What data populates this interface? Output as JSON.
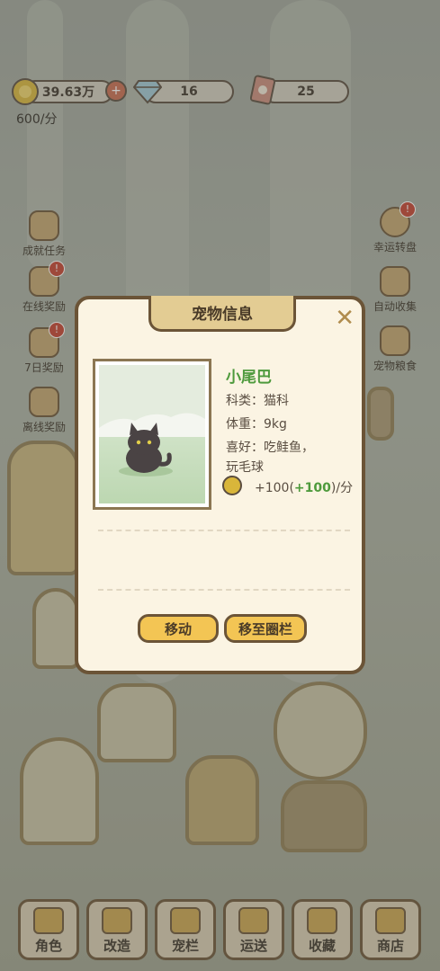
{
  "resources": {
    "coins": "39.63万",
    "diamonds": "16",
    "tickets": "25",
    "rate": "600/分"
  },
  "side_left": [
    {
      "label": "成就任务",
      "icon": "flower-medal-icon",
      "badge": ""
    },
    {
      "label": "在线奖励",
      "icon": "clock-icon",
      "badge": "!"
    },
    {
      "label": "7日奖励",
      "icon": "calendar-icon",
      "badge": "!"
    },
    {
      "label": "离线奖励",
      "icon": "coin-arrow-icon",
      "badge": ""
    }
  ],
  "side_right": [
    {
      "label": "幸运转盘",
      "icon": "wheel-icon",
      "badge": "!"
    },
    {
      "label": "自动收集",
      "icon": "hourglass-icon",
      "badge": ""
    },
    {
      "label": "宠物粮食",
      "icon": "food-bowl-icon",
      "badge": ""
    }
  ],
  "dialog": {
    "title": "宠物信息",
    "pet_name": "小尾巴",
    "category": "科类：猫科",
    "weight": "体重：9kg",
    "likes_line1": "喜好：吃鲑鱼，",
    "likes_line2": "玩毛球",
    "income_base": "+100(",
    "income_bonus": "+100",
    "income_tail": ")/分",
    "move_button": "移动",
    "to_pen_button": "移至圈栏"
  },
  "bottom_nav": [
    {
      "label": "角色",
      "icon": "shirt-icon"
    },
    {
      "label": "改造",
      "icon": "layout-icon"
    },
    {
      "label": "宠栏",
      "icon": "fence-icon"
    },
    {
      "label": "运送",
      "icon": "truck-icon"
    },
    {
      "label": "收藏",
      "icon": "house-icon"
    },
    {
      "label": "商店",
      "icon": "cart-icon"
    }
  ],
  "colors": {
    "accent": "#f3c554",
    "frame": "#6b5437",
    "name_green": "#4e9a3c",
    "panel": "#fbf4e3"
  }
}
